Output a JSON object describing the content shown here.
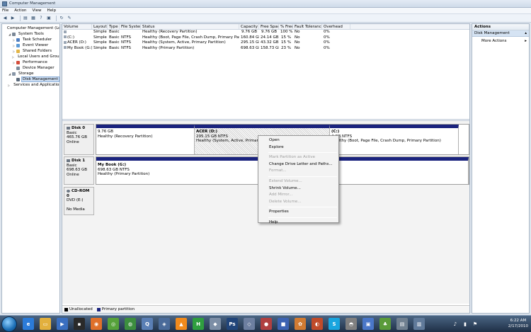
{
  "window": {
    "title": "Computer Management"
  },
  "menu": [
    "File",
    "Action",
    "View",
    "Help"
  ],
  "toolbar": [
    "back-icon",
    "forward-icon",
    "up-icon",
    "properties-icon",
    "help-icon",
    "show-hide-icon",
    "refresh-icon",
    "settings-icon"
  ],
  "tree": [
    {
      "label": "Computer Management (Local",
      "indent": 0,
      "exp": "",
      "color": "#6f7f92"
    },
    {
      "label": "System Tools",
      "indent": 1,
      "exp": "◢",
      "color": "#7a8796"
    },
    {
      "label": "Task Scheduler",
      "indent": 2,
      "exp": "▷",
      "color": "#4f7ec0"
    },
    {
      "label": "Event Viewer",
      "indent": 2,
      "exp": "▷",
      "color": "#5e9bd6"
    },
    {
      "label": "Shared Folders",
      "indent": 2,
      "exp": "▷",
      "color": "#e3b545"
    },
    {
      "label": "Local Users and Groups",
      "indent": 2,
      "exp": "▷",
      "color": "#6a8fc3"
    },
    {
      "label": "Performance",
      "indent": 2,
      "exp": "▷",
      "color": "#d44d3a"
    },
    {
      "label": "Device Manager",
      "indent": 2,
      "exp": "",
      "color": "#7c8b9a"
    },
    {
      "label": "Storage",
      "indent": 1,
      "exp": "◢",
      "color": "#8896a7"
    },
    {
      "label": "Disk Management",
      "indent": 2,
      "exp": "",
      "color": "#5d6c7e",
      "selected": true
    },
    {
      "label": "Services and Applications",
      "indent": 1,
      "exp": "▷",
      "color": "#8aa24e"
    }
  ],
  "volumes": {
    "headers": [
      "Volume",
      "Layout",
      "Type",
      "File System",
      "Status",
      "Capacity",
      "Free Space",
      "% Free",
      "Fault Tolerance",
      "Overhead"
    ],
    "rows": [
      [
        "",
        "Simple",
        "Basic",
        "",
        "Healthy (Recovery Partition)",
        "9.76 GB",
        "9.76 GB",
        "100 %",
        "No",
        "0%"
      ],
      [
        "(C:)",
        "Simple",
        "Basic",
        "NTFS",
        "Healthy (Boot, Page File, Crash Dump, Primary Partition)",
        "160.84 GB",
        "24.14 GB",
        "15 %",
        "No",
        "0%"
      ],
      [
        "ACER (D:)",
        "Simple",
        "Basic",
        "NTFS",
        "Healthy (System, Active, Primary Partition)",
        "295.15 GB",
        "43.32 GB",
        "15 %",
        "No",
        "0%"
      ],
      [
        "My Book (G:)",
        "Simple",
        "Basic",
        "NTFS",
        "Healthy (Primary Partition)",
        "698.63 GB",
        "158.73 GB",
        "23 %",
        "No",
        "0%"
      ]
    ]
  },
  "disks": [
    {
      "name": "Disk 0",
      "type": "Basic",
      "size": "465.76 GB",
      "status": "Online",
      "partitions": [
        {
          "name": "",
          "size": "9.76 GB",
          "status": "Healthy (Recovery Partition)"
        },
        {
          "name": "ACER (D:)",
          "size": "295.15 GB NTFS",
          "status": "Healthy (System, Active, Primary Partition)"
        },
        {
          "name": "(C:)",
          "size": "4 GB NTFS",
          "status": "Healthy (Boot, Page File, Crash Dump, Primary Partition)"
        }
      ]
    },
    {
      "name": "Disk 1",
      "type": "Basic",
      "size": "698.63 GB",
      "status": "Online",
      "partitions": [
        {
          "name": "My Book (G:)",
          "size": "698.63 GB NTFS",
          "status": "Healthy (Primary Partition)"
        }
      ]
    },
    {
      "name": "CD-ROM 0",
      "type": "DVD (E:)",
      "size": "",
      "status": "No Media"
    }
  ],
  "legend": [
    {
      "label": "Unallocated",
      "color": "#000000"
    },
    {
      "label": "Primary partition",
      "color": "#1a237e"
    }
  ],
  "context_menu": [
    {
      "label": "Open",
      "enabled": true
    },
    {
      "label": "Explore",
      "enabled": true
    },
    {
      "sep": true
    },
    {
      "label": "Mark Partition as Active",
      "enabled": false
    },
    {
      "label": "Change Drive Letter and Paths...",
      "enabled": true
    },
    {
      "label": "Format...",
      "enabled": false
    },
    {
      "sep": true
    },
    {
      "label": "Extend Volume...",
      "enabled": false
    },
    {
      "label": "Shrink Volume...",
      "enabled": true
    },
    {
      "label": "Add Mirror...",
      "enabled": false
    },
    {
      "label": "Delete Volume...",
      "enabled": false
    },
    {
      "sep": true
    },
    {
      "label": "Properties",
      "enabled": true
    },
    {
      "sep": true
    },
    {
      "label": "Help",
      "enabled": true
    }
  ],
  "actions": {
    "title": "Actions",
    "section": "Disk Management",
    "item": "More Actions"
  },
  "taskbar": {
    "time": "6:22 AM",
    "date": "2/17/2010",
    "apps": [
      {
        "name": "ie-icon",
        "color": "#2b7bd8",
        "glyph": "e"
      },
      {
        "name": "explorer-icon",
        "color": "#e2b03e",
        "glyph": "▭"
      },
      {
        "name": "media-player-icon",
        "color": "#3a6fc0",
        "glyph": "▶"
      },
      {
        "name": "terminal-icon",
        "color": "#2a2a2a",
        "glyph": "▪"
      },
      {
        "name": "firefox-icon",
        "color": "#e0702a",
        "glyph": "◉"
      },
      {
        "name": "green-app-icon",
        "color": "#56a23a",
        "glyph": "◎"
      },
      {
        "name": "chrome-icon",
        "color": "#3c8e3e",
        "glyph": "◍"
      },
      {
        "name": "quicktime-icon",
        "color": "#5a7fb5",
        "glyph": "Q"
      },
      {
        "name": "tool-icon",
        "color": "#4a6b9a",
        "glyph": "◈"
      },
      {
        "name": "vlc-icon",
        "color": "#f08a1c",
        "glyph": "▲"
      },
      {
        "name": "green-h-icon",
        "color": "#2f9e3f",
        "glyph": "H"
      },
      {
        "name": "app-icon",
        "color": "#7c8ea6",
        "glyph": "◆"
      },
      {
        "name": "photoshop-icon",
        "color": "#21457a",
        "glyph": "Ps"
      },
      {
        "name": "app-icon",
        "color": "#6d7fa0",
        "glyph": "◇"
      },
      {
        "name": "app-icon",
        "color": "#b04040",
        "glyph": "●"
      },
      {
        "name": "app-icon",
        "color": "#3c63b2",
        "glyph": "■"
      },
      {
        "name": "app-icon",
        "color": "#d17b32",
        "glyph": "✿"
      },
      {
        "name": "app-icon",
        "color": "#c04b2a",
        "glyph": "◐"
      },
      {
        "name": "skype-icon",
        "color": "#19a5df",
        "glyph": "S"
      },
      {
        "name": "app-icon",
        "color": "#808080",
        "glyph": "◓"
      },
      {
        "name": "app-icon",
        "color": "#4a77c8",
        "glyph": "▣"
      },
      {
        "name": "app-icon",
        "color": "#5a9b3a",
        "glyph": "♣"
      },
      {
        "name": "app-icon",
        "color": "#708090",
        "glyph": "▤"
      },
      {
        "name": "computer-management-icon",
        "color": "#607a9a",
        "glyph": "▥"
      }
    ]
  }
}
